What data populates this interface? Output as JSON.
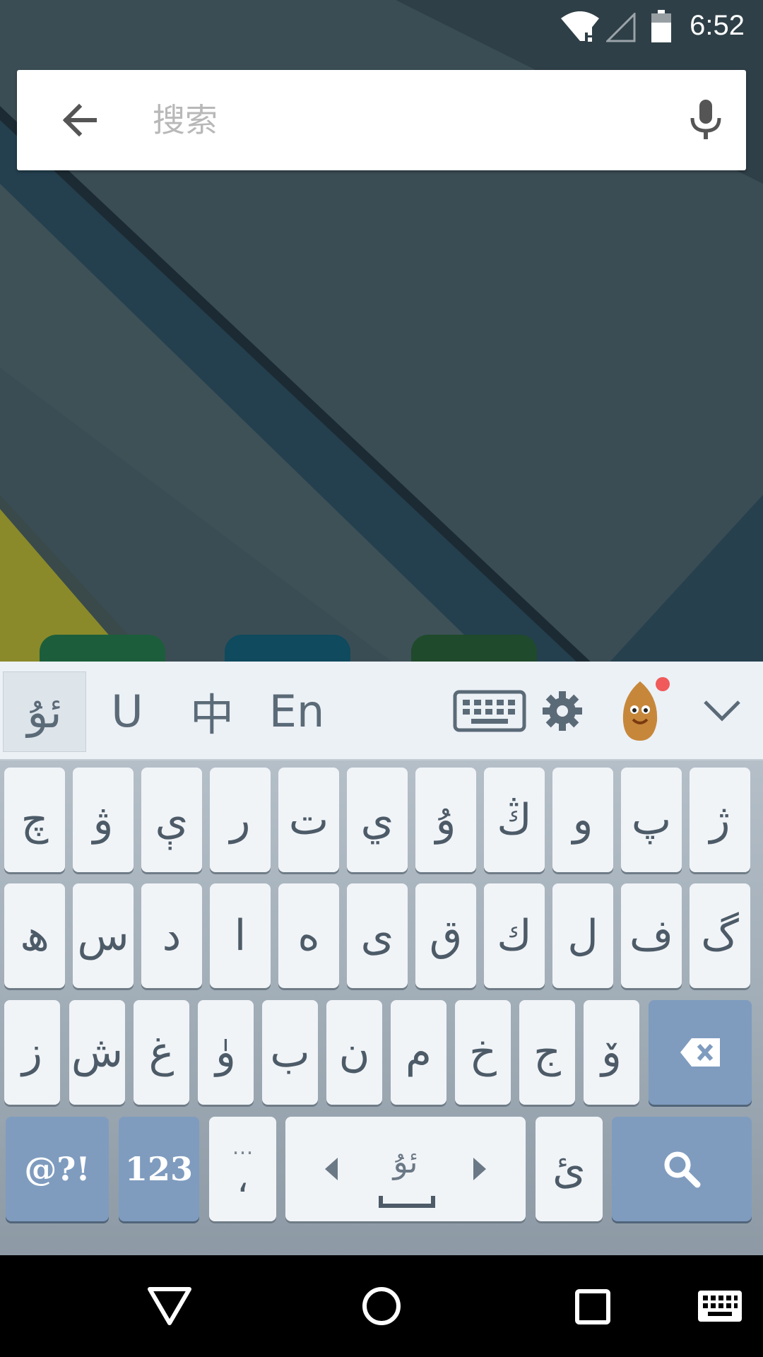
{
  "status_bar": {
    "time": "6:52",
    "icons": [
      "wifi-alert-icon",
      "no-signal-icon",
      "battery-icon"
    ]
  },
  "search": {
    "placeholder": "搜索",
    "value": "",
    "back_icon": "arrow-left-icon",
    "mic_icon": "microphone-icon"
  },
  "keyboard": {
    "toolbar": {
      "modes": [
        "ئۇ",
        "U",
        "中",
        "En"
      ],
      "active_mode": "ئۇ",
      "icons": [
        "keyboard-icon",
        "gear-icon",
        "mascot-icon",
        "chevron-down-icon"
      ]
    },
    "row1": [
      "ژ",
      "پ",
      "و",
      "ڭ",
      "ۇ",
      "ي",
      "ت",
      "ر",
      "ې",
      "ۋ",
      "چ"
    ],
    "row2": [
      "گ",
      "ف",
      "ل",
      "ك",
      "ق",
      "ى",
      "ە",
      "ا",
      "د",
      "س",
      "ھ"
    ],
    "row3": [
      "ۆ",
      "ج",
      "خ",
      "م",
      "ن",
      "ب",
      "ۈ",
      "غ",
      "ش",
      "ز"
    ],
    "bottom": {
      "symbols": "@?!",
      "numbers": "123",
      "punct_top": "…",
      "punct": "،",
      "space_label": "ئۇ",
      "hamza": "ئ"
    },
    "colors": {
      "accent_key": "#7f9cbf",
      "key": "#f1f4f7"
    }
  },
  "nav_bar": {
    "icons": [
      "back-triangle-icon",
      "home-circle-icon",
      "recents-square-icon",
      "keyboard-switch-icon"
    ]
  }
}
